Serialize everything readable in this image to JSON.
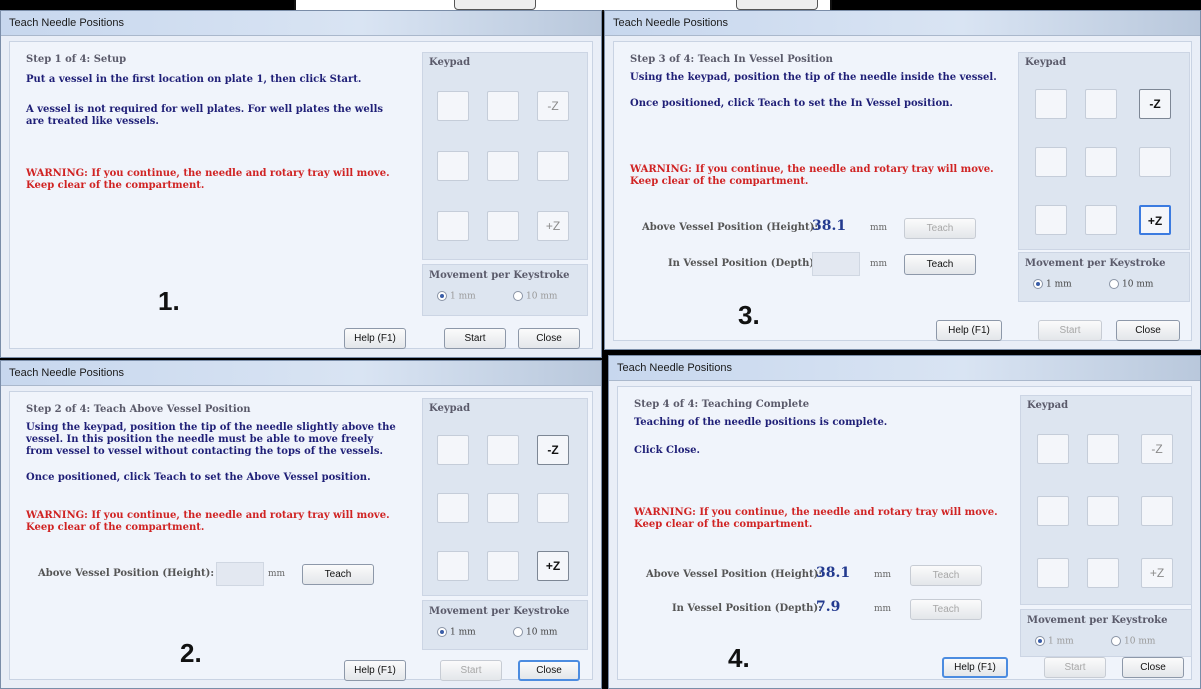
{
  "window_title": "Teach Needle Positions",
  "keypad_title": "Keypad",
  "minus_z": "-Z",
  "plus_z": "+Z",
  "movement_title": "Movement per Keystroke",
  "opt_1mm": "1 mm",
  "opt_10mm": "10 mm",
  "help_label": "Help (F1)",
  "start_label": "Start",
  "close_label": "Close",
  "teach_label": "Teach",
  "unit_mm": "mm",
  "warning_1": "WARNING: If you continue, the needle and rotary tray will move.",
  "warning_2": "Keep clear of the compartment.",
  "above_label": "Above Vessel Position (Height):",
  "in_label": "In Vessel Position (Depth):",
  "d1": {
    "step": "Step 1 of 4: Setup",
    "line1": "Put a vessel in the first location on plate 1, then click Start.",
    "line2": "A vessel is not required for well plates. For well plates the wells",
    "line3": "are treated like vessels.",
    "number": "1."
  },
  "d2": {
    "step": "Step 2 of 4: Teach Above Vessel Position",
    "line1": "Using the keypad, position the tip of the needle slightly above the",
    "line2": "vessel. In this position the needle must be able to move freely",
    "line3": "from vessel to vessel without contacting the tops of the vessels.",
    "line4": "Once positioned, click Teach to set the Above Vessel position.",
    "number": "2."
  },
  "d3": {
    "step": "Step 3 of 4: Teach In Vessel Position",
    "line1": "Using the keypad, position the tip of the needle inside the vessel.",
    "line2": "Once positioned, click Teach to set the In Vessel position.",
    "above_value": "38.1",
    "number": "3."
  },
  "d4": {
    "step": "Step 4 of 4: Teaching Complete",
    "line1": "Teaching of the needle positions is complete.",
    "line2": "Click Close.",
    "above_value": "38.1",
    "in_value": "7.9",
    "number": "4."
  }
}
